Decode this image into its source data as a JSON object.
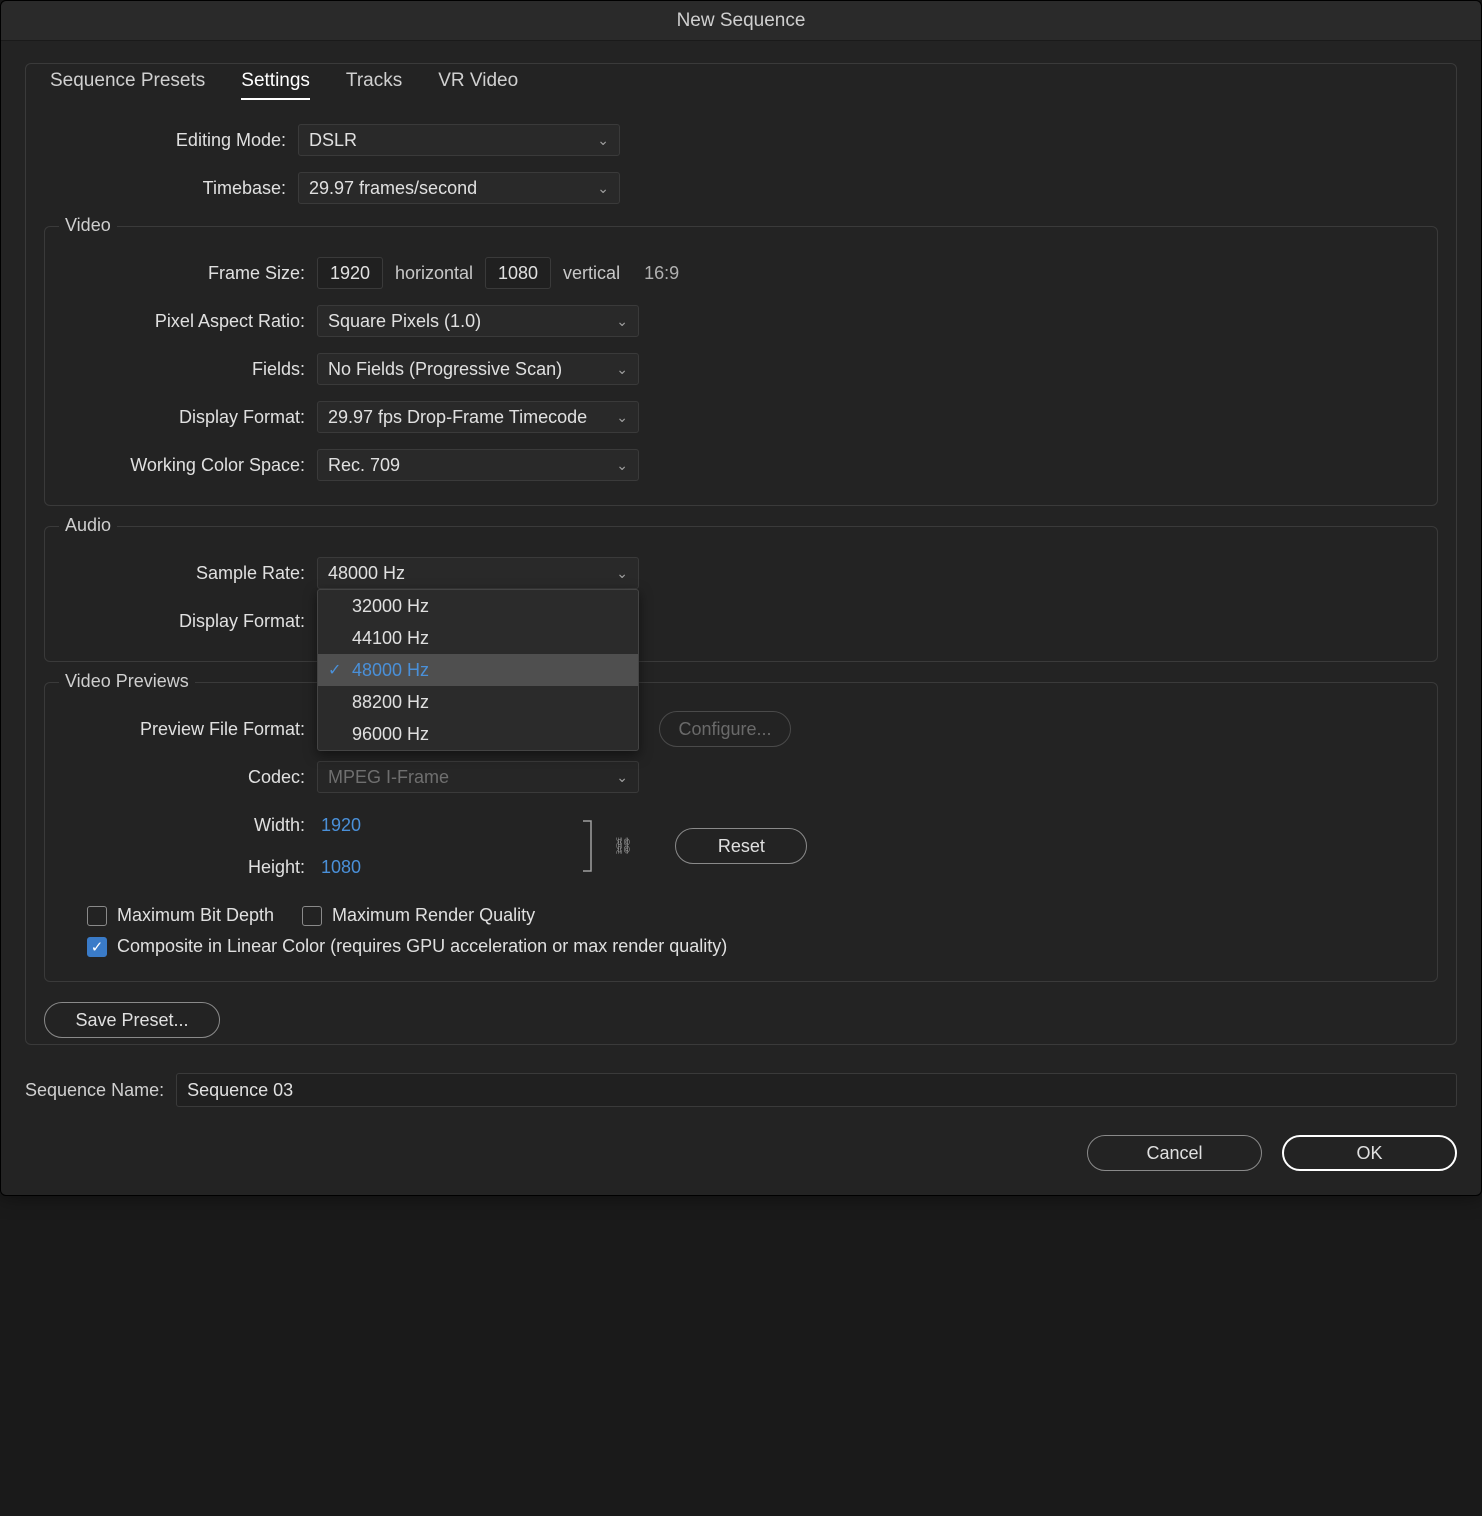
{
  "dialog": {
    "title": "New Sequence"
  },
  "tabs": {
    "presets": "Sequence Presets",
    "settings": "Settings",
    "tracks": "Tracks",
    "vr": "VR Video"
  },
  "top": {
    "editing_mode_label": "Editing Mode:",
    "editing_mode_value": "DSLR",
    "timebase_label": "Timebase:",
    "timebase_value": "29.97  frames/second"
  },
  "video": {
    "legend": "Video",
    "frame_size_label": "Frame Size:",
    "width": "1920",
    "horizontal": "horizontal",
    "height": "1080",
    "vertical": "vertical",
    "aspect": "16:9",
    "par_label": "Pixel Aspect Ratio:",
    "par_value": "Square Pixels (1.0)",
    "fields_label": "Fields:",
    "fields_value": "No Fields (Progressive Scan)",
    "display_format_label": "Display Format:",
    "display_format_value": "29.97 fps Drop-Frame Timecode",
    "wcs_label": "Working Color Space:",
    "wcs_value": "Rec. 709"
  },
  "audio": {
    "legend": "Audio",
    "sample_rate_label": "Sample Rate:",
    "sample_rate_value": "48000 Hz",
    "display_format_label": "Display Format:",
    "options": {
      "o0": "32000 Hz",
      "o1": "44100 Hz",
      "o2": "48000 Hz",
      "o3": "88200 Hz",
      "o4": "96000 Hz"
    }
  },
  "previews": {
    "legend": "Video Previews",
    "preview_format_label": "Preview File Format:",
    "configure": "Configure...",
    "codec_label": "Codec:",
    "codec_value": "MPEG I-Frame",
    "width_label": "Width:",
    "width_value": "1920",
    "height_label": "Height:",
    "height_value": "1080",
    "reset": "Reset",
    "max_bit_depth": "Maximum Bit Depth",
    "max_render_quality": "Maximum Render Quality",
    "composite_linear": "Composite in Linear Color (requires GPU acceleration or max render quality)"
  },
  "save_preset": "Save Preset...",
  "sequence_name_label": "Sequence Name:",
  "sequence_name_value": "Sequence 03",
  "footer": {
    "cancel": "Cancel",
    "ok": "OK"
  }
}
